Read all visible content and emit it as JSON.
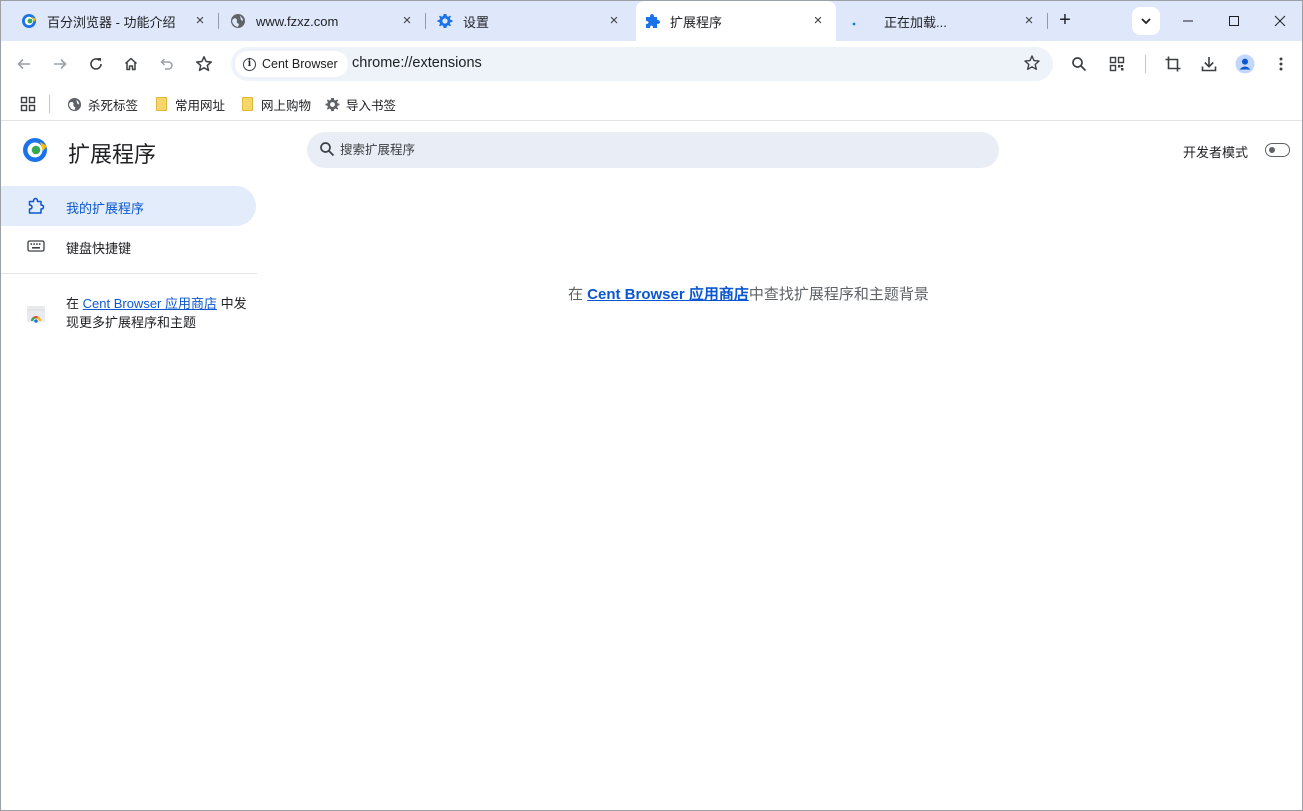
{
  "tabs": [
    {
      "title": "百分浏览器 - 功能介绍",
      "icon": "cent-browser-icon",
      "close": "×"
    },
    {
      "title": "www.fzxz.com",
      "icon": "globe-icon",
      "close": "×"
    },
    {
      "title": "设置",
      "icon": "gear-icon",
      "close": "×"
    },
    {
      "title": "扩展程序",
      "icon": "puzzle-icon",
      "close": "×",
      "active": true
    },
    {
      "title": "正在加载...",
      "icon": "loading-icon",
      "close": "×"
    }
  ],
  "new_tab_label": "+",
  "toolbar": {
    "security_chip": "Cent Browser",
    "url": "chrome://extensions"
  },
  "bookmarks": [
    {
      "label": "杀死标签",
      "icon": "globe-icon"
    },
    {
      "label": "常用网址",
      "icon": "folder-icon"
    },
    {
      "label": "网上购物",
      "icon": "folder-icon"
    },
    {
      "label": "导入书签",
      "icon": "gear-icon"
    }
  ],
  "page": {
    "title": "扩展程序",
    "search_placeholder": "搜索扩展程序",
    "developer_mode_label": "开发者模式",
    "developer_mode_on": false,
    "nav": [
      {
        "label": "我的扩展程序",
        "active": true
      },
      {
        "label": "键盘快捷键",
        "active": false
      }
    ],
    "store_promo": {
      "prefix": "在 ",
      "link": "Cent Browser 应用商店",
      "suffix": " 中发现更多扩展程序和主题"
    },
    "empty_message": {
      "prefix": "在 ",
      "link": "Cent Browser 应用商店",
      "suffix": "中查找扩展程序和主题背景"
    }
  },
  "colors": {
    "tabstrip": "#dfe8fb",
    "accent": "#0b57d0",
    "nav_active_bg": "#e3ecfb"
  }
}
